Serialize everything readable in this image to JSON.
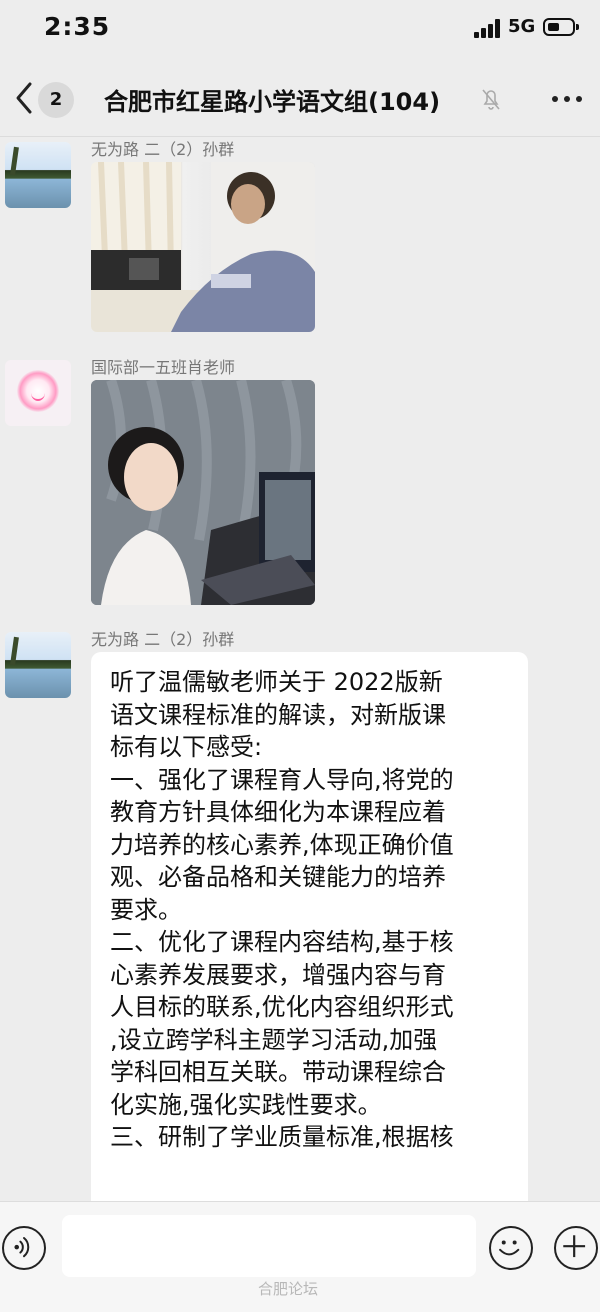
{
  "status_bar": {
    "time": "2:35",
    "network": "5G"
  },
  "nav": {
    "unread_count": "2",
    "title": "合肥市红星路小学语文组(104)"
  },
  "messages": [
    {
      "sender": "无为路 二（2）孙群",
      "kind": "image"
    },
    {
      "sender": "国际部一五班肖老师",
      "kind": "image"
    },
    {
      "sender": "无为路 二（2）孙群",
      "kind": "text",
      "lines": [
        "听了温儒敏老师关于 2022版新",
        "语文课程标准的解读，对新版课",
        "标有以下感受:",
        "一、强化了课程育人导向,将党的",
        "教育方针具体细化为本课程应着",
        "力培养的核心素养,体现正确价值",
        "观、必备品格和关键能力的培养",
        "要求。",
        "二、优化了课程内容结构,基于核",
        "心素养发展要求，增强内容与育",
        "人目标的联系,优化内容组织形式",
        ",设立跨学科主题学习活动,加强",
        "学科回相互关联。带动课程综合",
        "化实施,强化实践性要求。",
        "三、研制了学业质量标准,根据核"
      ]
    }
  ],
  "watermark": "合肥论坛",
  "icons": {
    "back": "chevron-left-icon",
    "mute": "bell-slash-icon",
    "more": "more-dots-icon",
    "voice": "voice-icon",
    "emoji": "emoji-icon",
    "add": "plus-icon"
  }
}
